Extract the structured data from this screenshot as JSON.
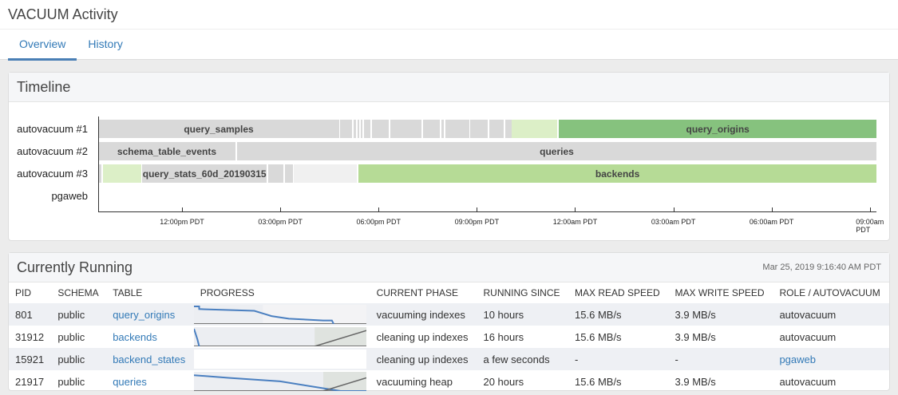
{
  "title": "VACUUM Activity",
  "tabs": [
    {
      "label": "Overview"
    },
    {
      "label": "History"
    }
  ],
  "timeline": {
    "title": "Timeline",
    "domain_hours_from_noon": [
      -2.56,
      21.2
    ],
    "rows": [
      {
        "label": "autovacuum #1",
        "segments": [
          {
            "name": "query_samples",
            "start": -2.56,
            "end": 4.8,
            "style": "gray"
          },
          {
            "start": 4.83,
            "end": 5.2,
            "style": "gray"
          },
          {
            "start": 5.25,
            "end": 5.3,
            "style": "gray"
          },
          {
            "start": 5.35,
            "end": 5.4,
            "style": "gray"
          },
          {
            "start": 5.45,
            "end": 5.5,
            "style": "gray"
          },
          {
            "start": 5.55,
            "end": 5.75,
            "style": "gray"
          },
          {
            "start": 5.8,
            "end": 6.32,
            "style": "gray"
          },
          {
            "start": 6.37,
            "end": 7.3,
            "style": "gray"
          },
          {
            "start": 7.35,
            "end": 7.88,
            "style": "gray"
          },
          {
            "start": 7.93,
            "end": 7.98,
            "style": "gray"
          },
          {
            "start": 8.03,
            "end": 8.76,
            "style": "gray"
          },
          {
            "start": 8.8,
            "end": 9.34,
            "style": "gray"
          },
          {
            "start": 9.39,
            "end": 9.83,
            "style": "gray"
          },
          {
            "start": 9.88,
            "end": 10.07,
            "style": "gray"
          },
          {
            "start": 10.07,
            "end": 11.46,
            "style": "palegreen"
          },
          {
            "name": "query_origins",
            "start": 11.51,
            "end": 21.2,
            "style": "green"
          }
        ]
      },
      {
        "label": "autovacuum #2",
        "segments": [
          {
            "name": "schema_table_events",
            "start": -2.56,
            "end": 1.63,
            "style": "gray"
          },
          {
            "name": "queries",
            "start": 1.68,
            "end": 21.2,
            "style": "gray"
          }
        ]
      },
      {
        "label": "autovacuum #3",
        "segments": [
          {
            "start": -2.56,
            "end": -2.46,
            "style": "gray"
          },
          {
            "start": -2.41,
            "end": -1.24,
            "style": "palegreen"
          },
          {
            "name": "query_stats_60d_20190315",
            "start": -1.22,
            "end": 2.59,
            "style": "gray"
          },
          {
            "start": 2.63,
            "end": 3.1,
            "style": "gray"
          },
          {
            "start": 3.15,
            "end": 3.39,
            "style": "gray"
          },
          {
            "start": 3.41,
            "end": 5.34,
            "style": "light"
          },
          {
            "name": "backends",
            "start": 5.39,
            "end": 21.2,
            "style": "lightgreen"
          }
        ]
      },
      {
        "label": "pgaweb",
        "segments": []
      }
    ],
    "ticks": [
      {
        "h": 0,
        "label": "12:00pm PDT"
      },
      {
        "h": 3,
        "label": "03:00pm PDT"
      },
      {
        "h": 6,
        "label": "06:00pm PDT"
      },
      {
        "h": 9,
        "label": "09:00pm PDT"
      },
      {
        "h": 12,
        "label": "12:00am PDT"
      },
      {
        "h": 15,
        "label": "03:00am PDT"
      },
      {
        "h": 18,
        "label": "06:00am PDT"
      },
      {
        "h": 21,
        "label": "09:00am PDT"
      }
    ]
  },
  "running": {
    "title": "Currently Running",
    "timestamp": "Mar 25, 2019 9:16:40 AM PDT",
    "columns": [
      "PID",
      "SCHEMA",
      "TABLE",
      "PROGRESS",
      "CURRENT PHASE",
      "RUNNING SINCE",
      "MAX READ SPEED",
      "MAX WRITE SPEED",
      "ROLE / AUTOVACUUM"
    ],
    "rows": [
      {
        "pid": "801",
        "schema": "public",
        "table": "query_origins",
        "phase": "vacuuming indexes",
        "since": "10 hours",
        "read": "15.6 MB/s",
        "write": "3.9 MB/s",
        "role": "autovacuum",
        "role_link": false,
        "progress": {
          "remaining": [
            [
              0,
              1
            ],
            [
              0.03,
              1
            ],
            [
              0.03,
              0.85
            ],
            [
              0.35,
              0.75
            ],
            [
              0.4,
              0.6
            ],
            [
              0.45,
              0.45
            ],
            [
              0.55,
              0.3
            ],
            [
              0.75,
              0.2
            ],
            [
              0.8,
              0.2
            ],
            [
              0.81,
              0
            ]
          ],
          "done_until": 0.4,
          "write": []
        }
      },
      {
        "pid": "31912",
        "schema": "public",
        "table": "backends",
        "phase": "cleaning up indexes",
        "since": "16 hours",
        "read": "15.6 MB/s",
        "write": "3.9 MB/s",
        "role": "autovacuum",
        "role_link": false,
        "progress": {
          "remaining": [
            [
              0,
              1
            ],
            [
              0.02,
              0.4
            ],
            [
              0.03,
              0
            ]
          ],
          "done_until": 1,
          "write": [
            [
              0.7,
              0
            ],
            [
              1,
              0.9
            ]
          ]
        }
      },
      {
        "pid": "15921",
        "schema": "public",
        "table": "backend_states",
        "phase": "cleaning up indexes",
        "since": "a few seconds",
        "read": "-",
        "write": "-",
        "role": "pgaweb",
        "role_link": true,
        "progress": {
          "remaining": [],
          "done_until": 0,
          "write": []
        }
      },
      {
        "pid": "21917",
        "schema": "public",
        "table": "queries",
        "phase": "vacuuming heap",
        "since": "20 hours",
        "read": "15.6 MB/s",
        "write": "3.9 MB/s",
        "role": "autovacuum",
        "role_link": false,
        "progress": {
          "remaining": [
            [
              0,
              0.9
            ],
            [
              0.2,
              0.75
            ],
            [
              0.5,
              0.55
            ],
            [
              0.85,
              0
            ],
            [
              1,
              0
            ]
          ],
          "done_until": 0.75,
          "write": [
            [
              0.75,
              0
            ],
            [
              1,
              0.75
            ]
          ]
        }
      }
    ]
  }
}
